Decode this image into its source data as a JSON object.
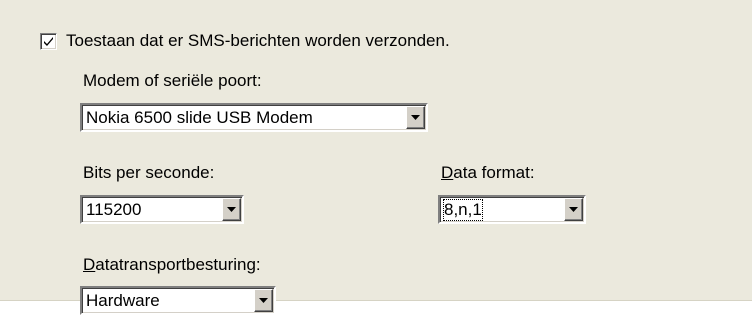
{
  "sms": {
    "allow_checkbox_label": "Toestaan dat er SMS-berichten worden verzonden.",
    "allow_checked": true
  },
  "modem": {
    "label": "Modem of seriële poort:",
    "value": "Nokia 6500 slide USB Modem"
  },
  "bits": {
    "label": "Bits per seconde:",
    "value": "115200"
  },
  "format": {
    "label_first": "D",
    "label_rest": "ata format:",
    "value": "8,n,1"
  },
  "flow": {
    "label_first": "D",
    "label_rest": "atatransportbesturing:",
    "value": "Hardware"
  },
  "icons": {
    "checkbox": "checkmark-icon",
    "dropdown": "dropdown-arrow-icon"
  },
  "colors": {
    "panel_bg": "#ebe9dd",
    "field_bg": "#ffffff",
    "button_face": "#d4d0c8"
  }
}
